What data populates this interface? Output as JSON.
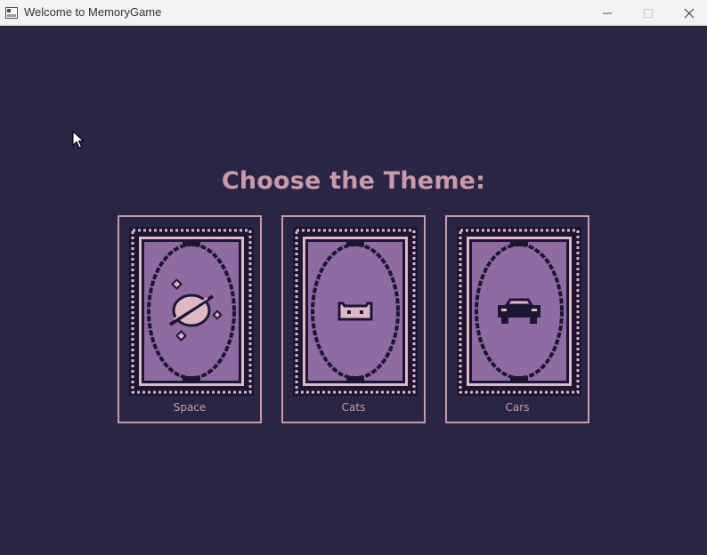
{
  "window": {
    "title": "Welcome to MemoryGame"
  },
  "main": {
    "heading": "Choose the Theme:"
  },
  "themes": [
    {
      "label": "Space",
      "icon": "planet-icon"
    },
    {
      "label": "Cats",
      "icon": "cat-icon"
    },
    {
      "label": "Cars",
      "icon": "car-icon"
    }
  ],
  "colors": {
    "background": "#2a2544",
    "accent": "#c99aaa",
    "card_fill": "#8e6ba3",
    "card_dark": "#1c1633",
    "card_light": "#e0b8c4"
  }
}
